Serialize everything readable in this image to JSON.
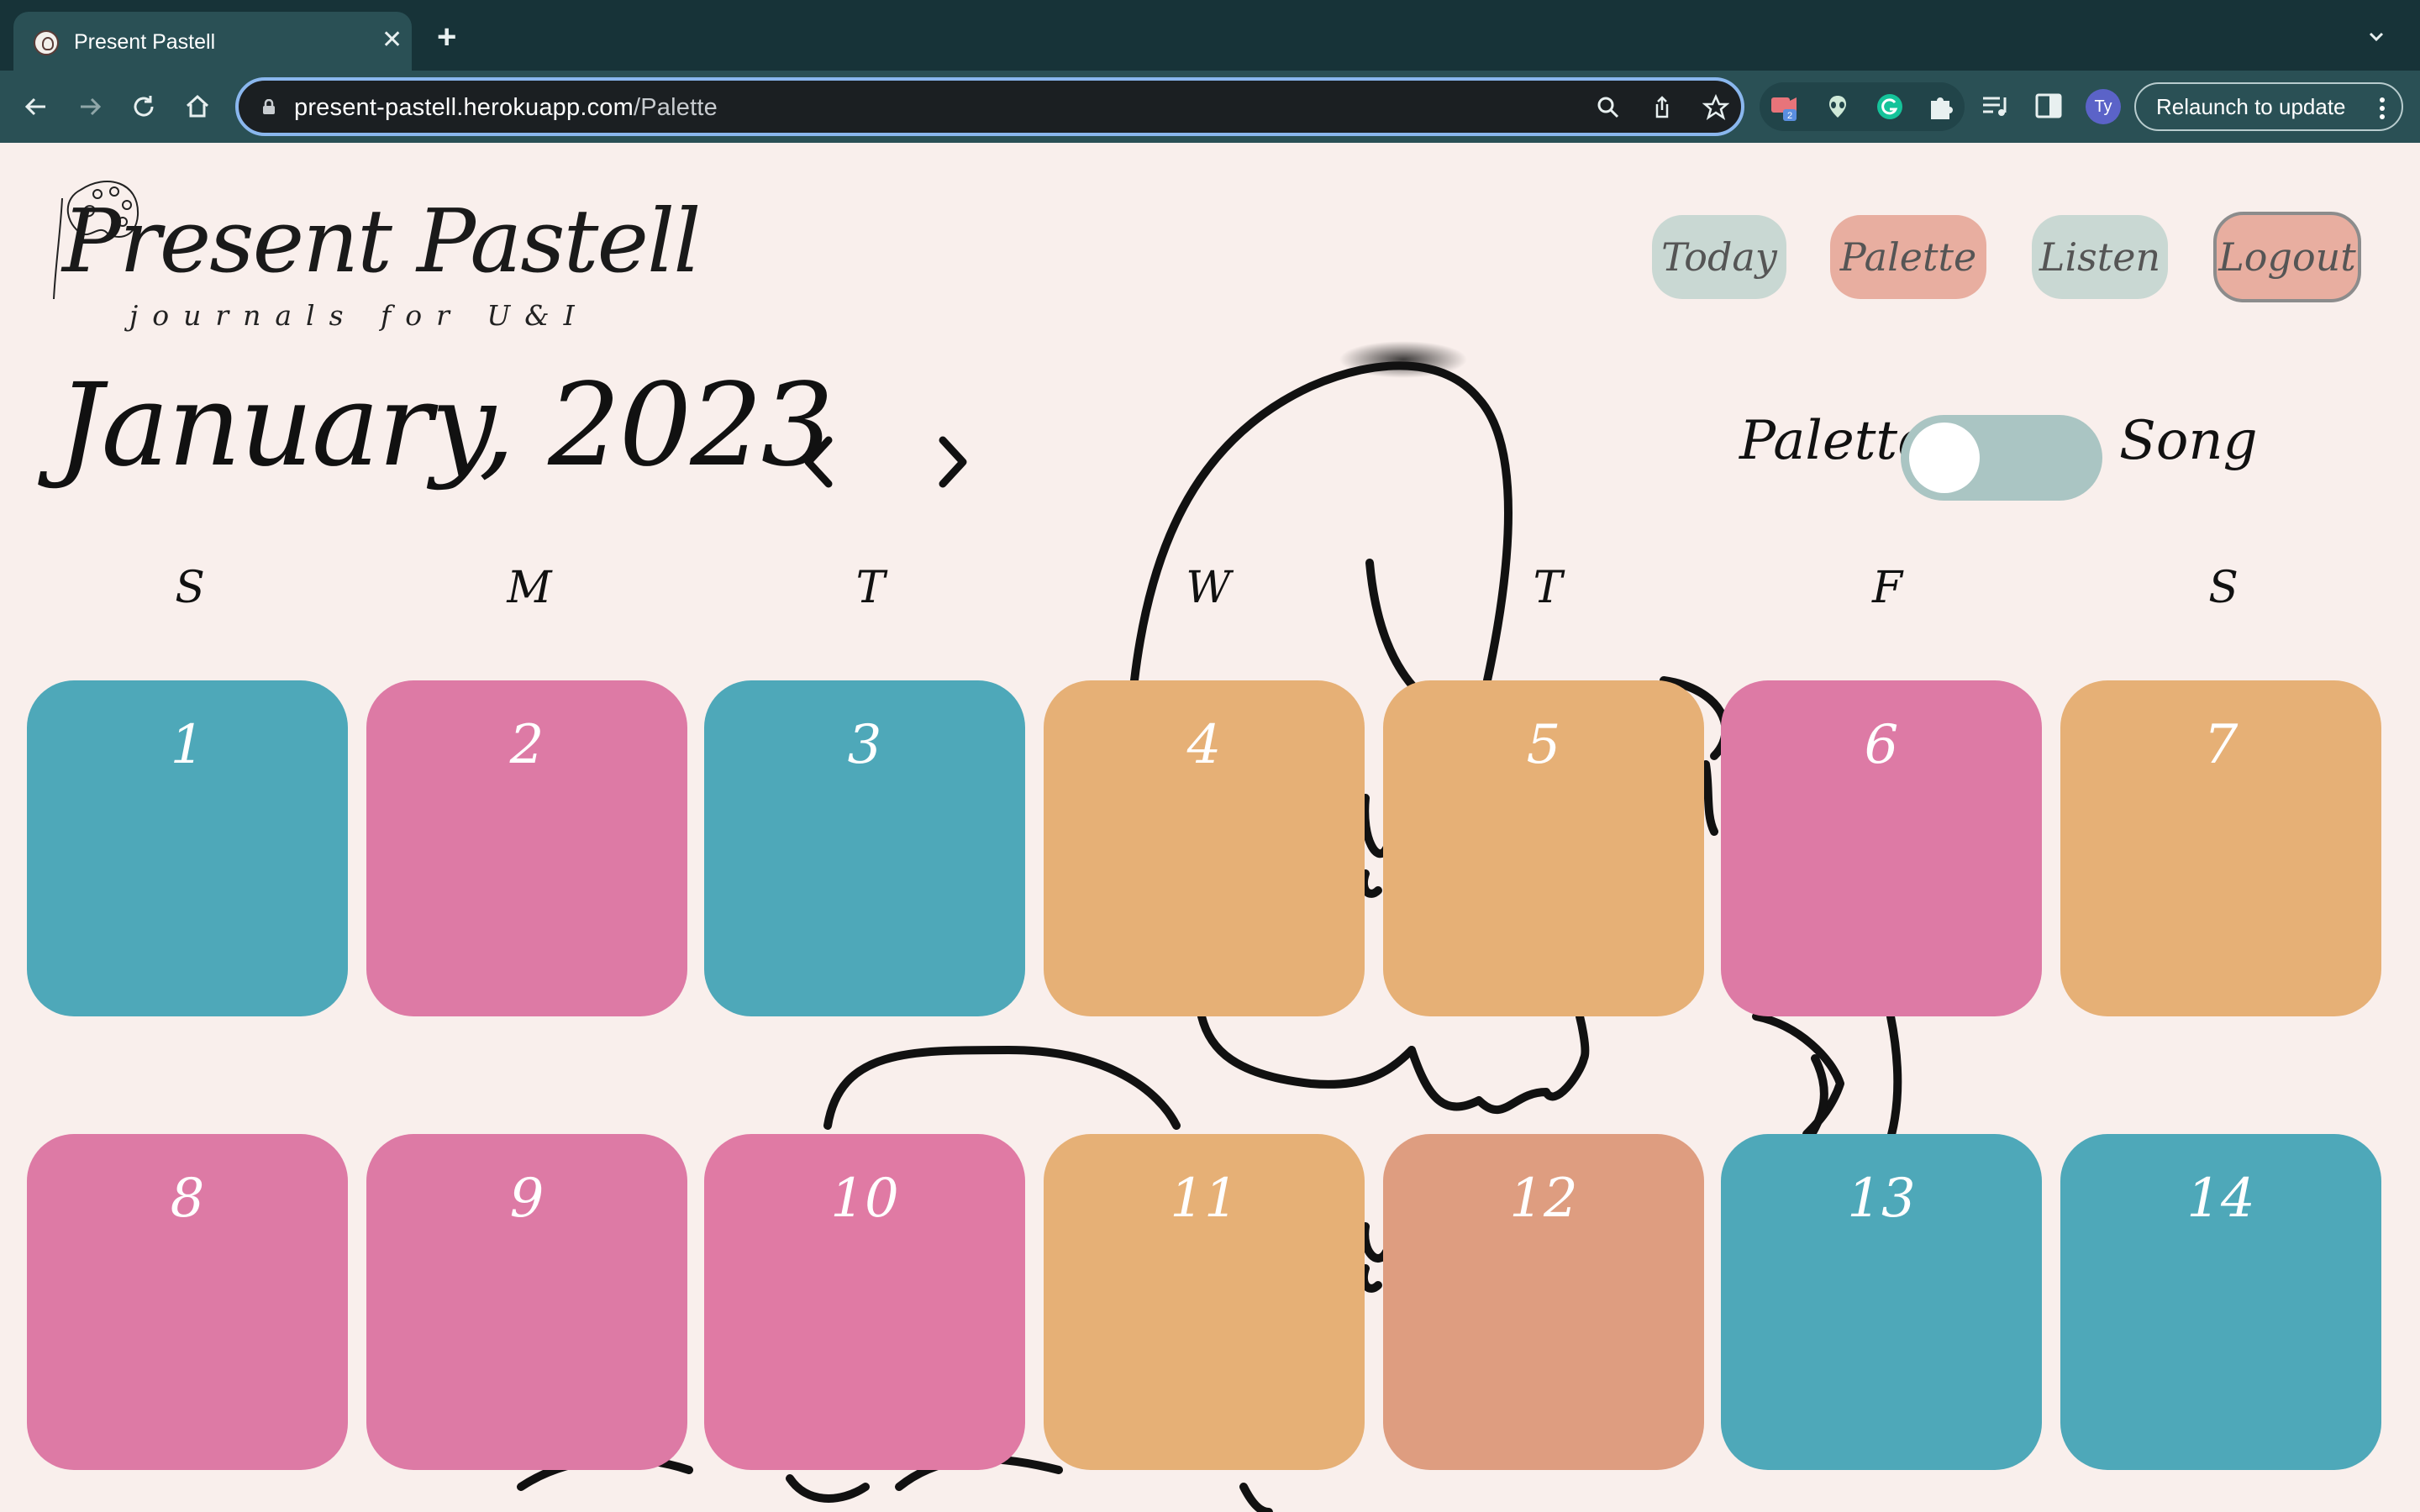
{
  "browser": {
    "tab_title": "Present Pastell",
    "tab_close": "✕",
    "new_tab": "+",
    "url_host": "present-pastell.herokuapp.com",
    "url_path": "/Palette",
    "extension_badge": "2",
    "avatar_initials": "Ty",
    "relaunch_label": "Relaunch to update"
  },
  "header": {
    "logo_title": "Present Pastell",
    "logo_subtitle": "journals for U&I",
    "nav": {
      "today": "Today",
      "palette": "Palette",
      "listen": "Listen",
      "logout": "Logout"
    }
  },
  "calendar": {
    "month_label": "January, 2023",
    "prev": "‹",
    "next": "›",
    "toggle_left_label": "Palette",
    "toggle_right_label": "Song",
    "toggle_state": "Palette",
    "weekdays": [
      "S",
      "M",
      "T",
      "W",
      "T",
      "F",
      "S"
    ],
    "days": [
      {
        "num": "1",
        "color": "#4ea8b9"
      },
      {
        "num": "2",
        "color": "#dd7aa5"
      },
      {
        "num": "3",
        "color": "#4ea8b9"
      },
      {
        "num": "4",
        "color": "#e6b076"
      },
      {
        "num": "5",
        "color": "#e6b076"
      },
      {
        "num": "6",
        "color": "#dd7aa5"
      },
      {
        "num": "7",
        "color": "#e6b076"
      },
      {
        "num": "8",
        "color": "#dd7aa5"
      },
      {
        "num": "9",
        "color": "#dd7aa5"
      },
      {
        "num": "10",
        "color": "#e07aa4"
      },
      {
        "num": "11",
        "color": "#e6b076"
      },
      {
        "num": "12",
        "color": "#de9d80"
      },
      {
        "num": "13",
        "color": "#4ea8b9"
      },
      {
        "num": "14",
        "color": "#4ea8b9"
      }
    ]
  }
}
